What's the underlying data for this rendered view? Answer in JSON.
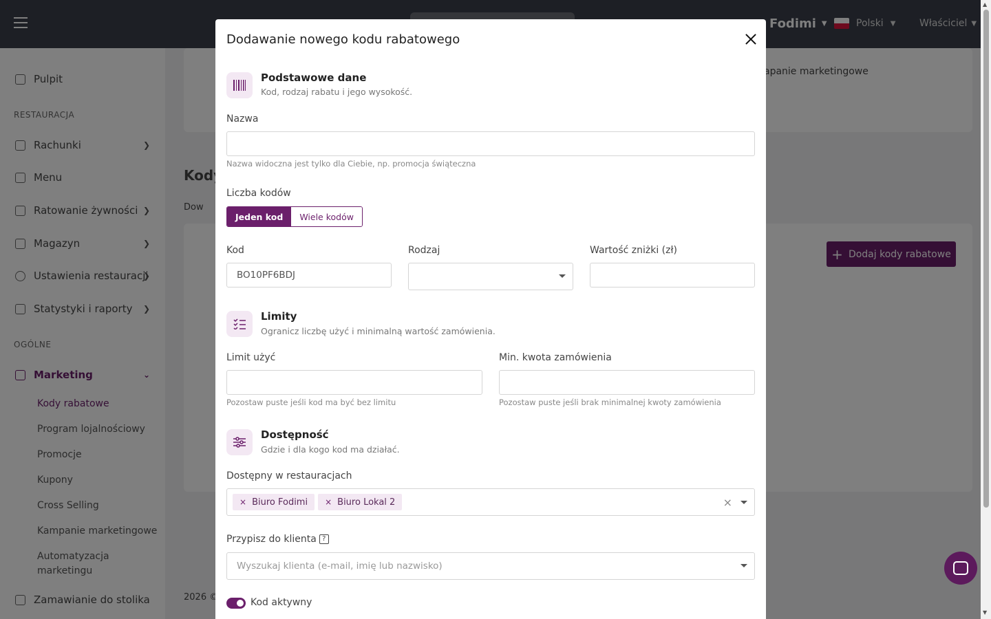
{
  "topbar": {
    "brand": "Fodimi",
    "language": "Polski",
    "user": "Właściciel"
  },
  "sidebar": {
    "dashboard": "Pulpit",
    "section_restaurant": "RESTAURACJA",
    "bills": "Rachunki",
    "menu": "Menu",
    "food_rescue": "Ratowanie żywności",
    "warehouse": "Magazyn",
    "restaurant_settings": "Ustawienia restauracji",
    "stats": "Statystyki i raporty",
    "section_general": "OGÓLNE",
    "marketing": "Marketing",
    "sub": [
      "Kody rabatowe",
      "Program lojalnościowy",
      "Promocje",
      "Kupony",
      "Cross Selling",
      "Kampanie marketingowe",
      "Automatyzacja marketingu"
    ],
    "table_order": "Zamawianie do stolika"
  },
  "background": {
    "page_title": "Kody",
    "info_snippet": "Dow",
    "tab_campaigns": "apanie marketingowe",
    "add_button": "Dodaj kody rabatowe",
    "footer": "2026 ©"
  },
  "modal": {
    "title": "Dodawanie nowego kodu rabatowego",
    "basic": {
      "title": "Podstawowe dane",
      "subtitle": "Kod, rodzaj rabatu i jego wysokość."
    },
    "name_label": "Nazwa",
    "name_value": "",
    "name_hint": "Nazwa widoczna jest tylko dla Ciebie, np. promocja świąteczna",
    "count_label": "Liczba kodów",
    "count_single": "Jeden kod",
    "count_multi": "Wiele kodów",
    "code_label": "Kod",
    "code_value": "BO10PF6BDJ",
    "type_label": "Rodzaj",
    "type_value": "",
    "discount_label": "Wartość zniżki (zł)",
    "discount_value": "",
    "limits": {
      "title": "Limity",
      "subtitle": "Ogranicz liczbę użyć i minimalną wartość zamówienia."
    },
    "usage_label": "Limit użyć",
    "usage_hint": "Pozostaw puste jeśli kod ma być bez limitu",
    "min_label": "Min. kwota zamówienia",
    "min_hint": "Pozostaw puste jeśli brak minimalnej kwoty zamówienia",
    "availability": {
      "title": "Dostępność",
      "subtitle": "Gdzie i dla kogo kod ma działać."
    },
    "restaurants_label": "Dostępny w restauracjach",
    "restaurants": [
      "Biuro Fodimi",
      "Biuro Lokal 2"
    ],
    "client_label": "Przypisz do klienta",
    "client_placeholder": "Wyszukaj klienta (e-mail, imię lub nazwisko)",
    "active_label": "Kod aktywny",
    "active": true
  },
  "colors": {
    "accent": "#6b1f6b",
    "topbar": "#3a3f4b"
  }
}
